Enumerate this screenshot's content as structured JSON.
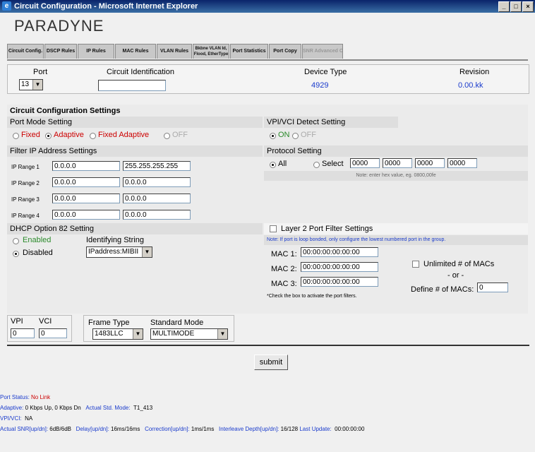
{
  "window": {
    "title": "Circuit Configuration - Microsoft Internet Explorer",
    "controls": [
      "_",
      "□",
      "×"
    ]
  },
  "logo": "PARADYNE",
  "tabs": [
    "Circuit Config.",
    "DSCP Rules",
    "IP Rules",
    "MAC Rules",
    "VLAN Rules",
    "Bkbne VLAN Id, Flood, EtherType",
    "Port Statistics",
    "Port Copy",
    "SNR Advanced Config."
  ],
  "port_table": {
    "headers": {
      "port": "Port",
      "circuit": "Circuit Identification",
      "device": "Device Type",
      "revision": "Revision"
    },
    "port_value": "13",
    "circuit_value": "",
    "device_value": "4929",
    "revision_value": "0.00.kk"
  },
  "settings": {
    "title": "Circuit Configuration Settings",
    "port_mode": {
      "label": "Port Mode Setting",
      "options": [
        "Fixed",
        "Adaptive",
        "Fixed Adaptive",
        "OFF"
      ],
      "selected": "Adaptive"
    },
    "vpivci_detect": {
      "label": "VPI/VCI Detect Setting",
      "on": "ON",
      "off": "OFF",
      "selected": "ON"
    },
    "filter_ip": {
      "label": "Filter IP Address Settings",
      "ranges": [
        {
          "label": "IP Range 1",
          "start": "0.0.0.0",
          "end": "255.255.255.255"
        },
        {
          "label": "IP Range 2",
          "start": "0.0.0.0",
          "end": "0.0.0.0"
        },
        {
          "label": "IP Range 3",
          "start": "0.0.0.0",
          "end": "0.0.0.0"
        },
        {
          "label": "IP Range 4",
          "start": "0.0.0.0",
          "end": "0.0.0.0"
        }
      ]
    },
    "protocol": {
      "label": "Protocol Setting",
      "all": "All",
      "select": "Select",
      "selected": "All",
      "values": [
        "0000",
        "0000",
        "0000",
        "0000"
      ],
      "note": "Note: enter hex value, eg. 0800,00fe"
    },
    "dhcp82": {
      "label": "DHCP Option 82 Setting",
      "enabled": "Enabled",
      "disabled": "Disabled",
      "selected": "Disabled",
      "id_string_label": "Identifying String",
      "id_string_value": "IPaddress:MIBII"
    },
    "layer2": {
      "label": "Layer 2 Port Filter Settings",
      "note": "Note: If port is loop bonded, only configure the lowest numbered port in the group.",
      "macs": [
        {
          "label": "MAC 1:",
          "value": "00:00:00:00:00:00"
        },
        {
          "label": "MAC 2:",
          "value": "00:00:00:00:00:00"
        },
        {
          "label": "MAC 3:",
          "value": "00:00:00:00:00:00"
        }
      ],
      "check_note": "*Check the box to activate the port filters.",
      "unlimited": "Unlimited # of MACs",
      "or": "- or -",
      "define_label": "Define # of MACs:",
      "define_value": "0"
    }
  },
  "vpivci": {
    "vpi_label": "VPI",
    "vci_label": "VCI",
    "vpi_value": "0",
    "vci_value": "0",
    "frame_type_label": "Frame Type",
    "frame_type_value": "1483LLC",
    "std_mode_label": "Standard Mode",
    "std_mode_value": "MULTIMODE"
  },
  "submit_label": "submit",
  "status": {
    "port_status_label": "Port Status:",
    "port_status_value": "No Link",
    "adaptive_label": "Adaptive:",
    "adaptive_value": "0 Kbps Up, 0 Kbps Dn",
    "std_mode_label": "Actual Std. Mode:",
    "std_mode_value": "T1_413",
    "vpivci_label": "VPI/VCI:",
    "vpivci_value": "NA",
    "snr_label": "Actual SNR[up/dn]:",
    "snr_value": "6dB/6dB",
    "delay_label": "Delay[up/dn]:",
    "delay_value": "16ms/16ms",
    "correction_label": "Correction[up/dn]:",
    "correction_value": "1ms/1ms",
    "interleave_label": "Interleave Depth[up/dn]:",
    "interleave_value": "16/128",
    "last_update_label": "Last Update:",
    "last_update_value": "00:00:00:00"
  }
}
